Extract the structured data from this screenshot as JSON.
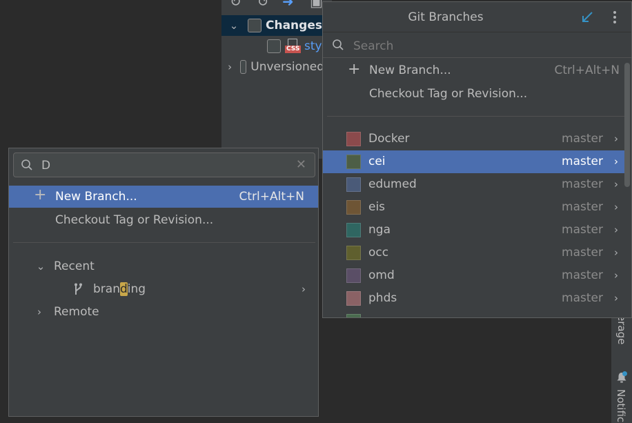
{
  "background": {
    "changes_label": "Changes",
    "style_file": "styl",
    "unversioned_label": "Unversioned",
    "coverage_tab": "erage",
    "notifications_tab": "Notific"
  },
  "left_popup": {
    "search_value": "D",
    "new_branch": {
      "label": "New Branch...",
      "shortcut": "Ctrl+Alt+N"
    },
    "checkout_label": "Checkout Tag or Revision...",
    "recent_label": "Recent",
    "recent_branch": {
      "before": "bran",
      "match": "d",
      "after": "ing"
    },
    "remote_label": "Remote"
  },
  "git_popup": {
    "title": "Git Branches",
    "search_placeholder": "Search",
    "new_branch": {
      "label": "New Branch...",
      "shortcut": "Ctrl+Alt+N"
    },
    "checkout_label": "Checkout Tag or Revision...",
    "repositories": [
      {
        "name": "Docker",
        "branch": "master",
        "color": "#8b4a4c"
      },
      {
        "name": "cei",
        "branch": "master",
        "color": "#4d5e46",
        "selected": true
      },
      {
        "name": "edumed",
        "branch": "master",
        "color": "#4a5a78"
      },
      {
        "name": "eis",
        "branch": "master",
        "color": "#6e5535"
      },
      {
        "name": "nga",
        "branch": "master",
        "color": "#2f6661"
      },
      {
        "name": "occ",
        "branch": "master",
        "color": "#5f5f2e"
      },
      {
        "name": "omd",
        "branch": "master",
        "color": "#5a4e66"
      },
      {
        "name": "phds",
        "branch": "master",
        "color": "#8a6265"
      },
      {
        "name": "",
        "branch": "",
        "color": "#4a6b4f"
      }
    ]
  },
  "colors": {
    "selection": "#4b6eaf",
    "search_match": "#c8a74a",
    "accent_icon": "#3592c4"
  }
}
